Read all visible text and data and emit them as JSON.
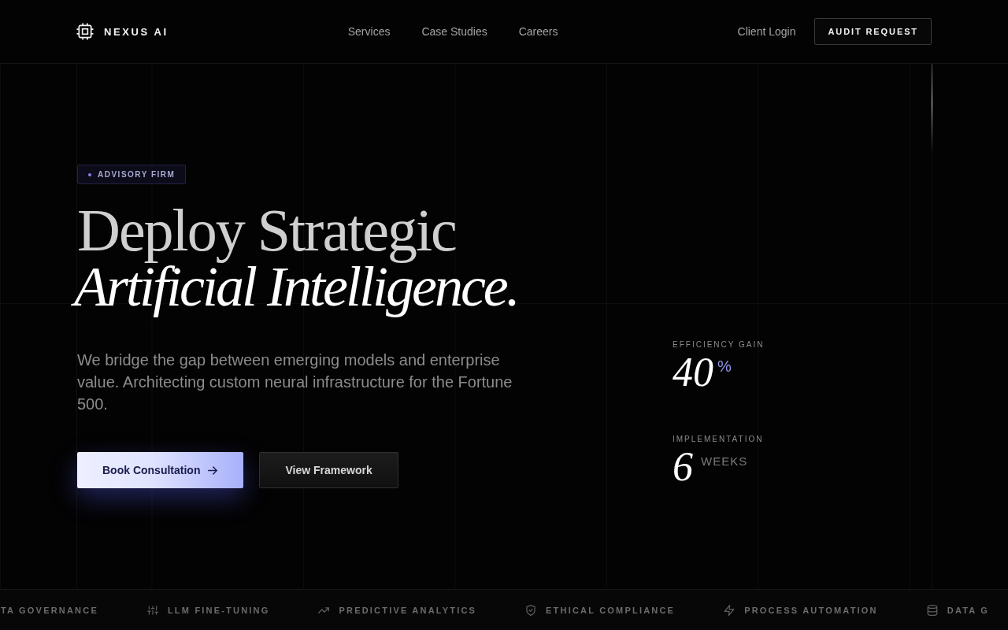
{
  "header": {
    "brand": "NEXUS AI",
    "nav": [
      "Services",
      "Case Studies",
      "Careers"
    ],
    "login": "Client Login",
    "cta": "AUDIT REQUEST"
  },
  "hero": {
    "tag": "ADVISORY FIRM",
    "heading": "Deploy Strategic *Artificial Intelligence.*",
    "description": "We bridge the gap between emerging models and enterprise value. Architecting custom neural infrastructure for the Fortune 500.",
    "buttons": [
      {
        "label": "Book Consultation",
        "kind": "primary"
      },
      {
        "label": "View Framework",
        "kind": "secondary"
      }
    ]
  },
  "stats": [
    {
      "label": "EFFICIENCY GAIN",
      "value": "40",
      "unit": "%",
      "kind": "symbol"
    },
    {
      "label": "IMPLEMENTATION",
      "value": "6",
      "unit": "WEEKS",
      "kind": "word"
    }
  ],
  "ticker": [
    "TA GOVERNANCE",
    "LLM FINE-TUNING",
    "PREDICTIVE ANALYTICS",
    "ETHICAL COMPLIANCE",
    "PROCESS AUTOMATION",
    "DATA G"
  ]
}
